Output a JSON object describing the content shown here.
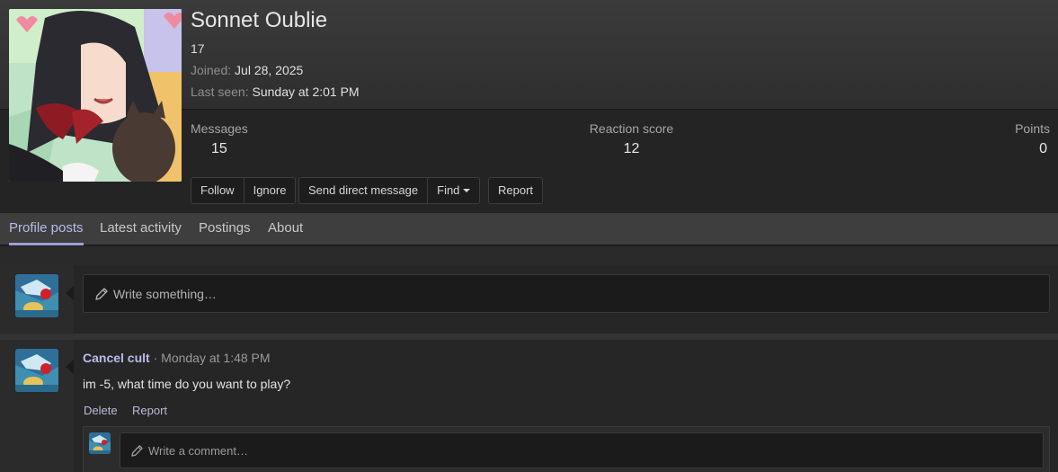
{
  "profile": {
    "username": "Sonnet Oublie",
    "title": "17",
    "joined_label": "Joined:",
    "joined_value": "Jul 28, 2025",
    "last_seen_label": "Last seen:",
    "last_seen_value": "Sunday at 2:01 PM"
  },
  "stats": {
    "messages_label": "Messages",
    "messages_value": "15",
    "reaction_label": "Reaction score",
    "reaction_value": "12",
    "points_label": "Points",
    "points_value": "0"
  },
  "actions": {
    "follow": "Follow",
    "ignore": "Ignore",
    "send_dm": "Send direct message",
    "find": "Find",
    "report": "Report"
  },
  "tabs": [
    {
      "label": "Profile posts",
      "active": true
    },
    {
      "label": "Latest activity",
      "active": false
    },
    {
      "label": "Postings",
      "active": false
    },
    {
      "label": "About",
      "active": false
    }
  ],
  "composer": {
    "placeholder": "Write something…"
  },
  "post": {
    "author": "Cancel cult",
    "separator": "·",
    "time": "Monday at 1:48 PM",
    "body": "im -5, what time do you want to play?",
    "delete_label": "Delete",
    "report_label": "Report",
    "comment_placeholder": "Write a comment…"
  },
  "colors": {
    "accent": "#b7bce9",
    "background": "#1e1e1e",
    "panel": "#262626"
  },
  "icons": [
    "pencil-icon",
    "caret-down-icon"
  ]
}
